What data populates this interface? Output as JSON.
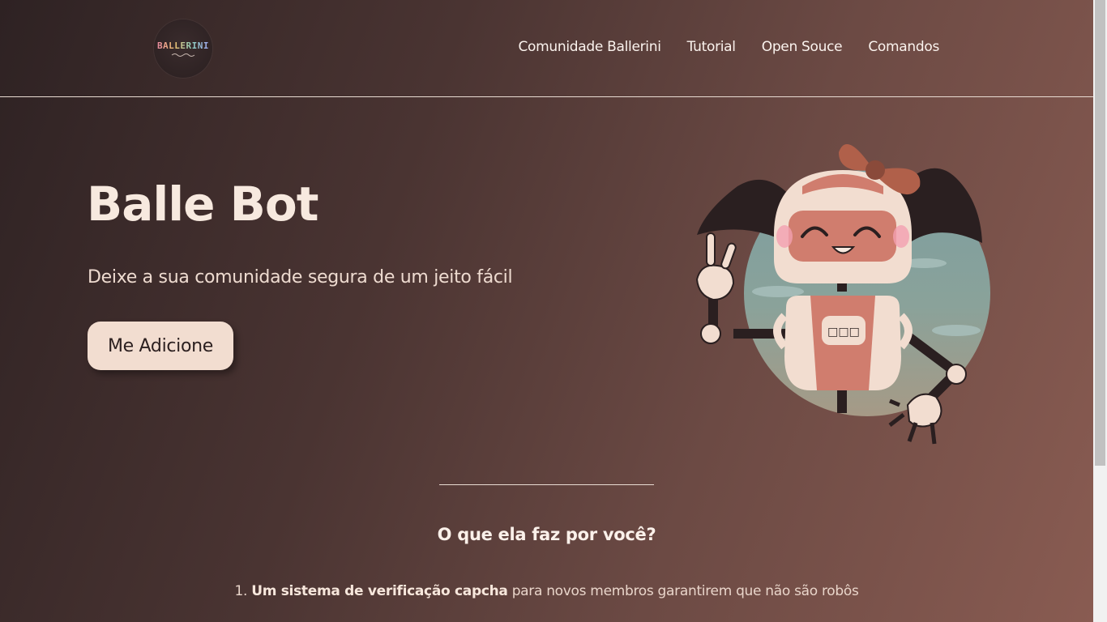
{
  "header": {
    "logo_text": "BALLERINI",
    "nav": [
      {
        "label": "Comunidade Ballerini"
      },
      {
        "label": "Tutorial"
      },
      {
        "label": "Open Souce"
      },
      {
        "label": "Comandos"
      }
    ]
  },
  "hero": {
    "title": "Balle Bot",
    "subtitle": "Deixe a sua comunidade segura de um jeito fácil",
    "cta_label": "Me Adicione",
    "illustration": "robot-girl-mascot",
    "screen_glyphs": "□□□"
  },
  "features": {
    "title": "O que ela faz por você?",
    "items": [
      {
        "number": "1.",
        "bold": "Um sistema de verificação capcha",
        "rest": "para novos membros garantirem que não são robôs"
      }
    ]
  },
  "colors": {
    "bg_dark": "#2e2223",
    "bg_light": "#8a5c52",
    "button_bg": "#f2ddd0",
    "accent_bow": "#b0604a",
    "robot_face": "#d07d6e"
  }
}
